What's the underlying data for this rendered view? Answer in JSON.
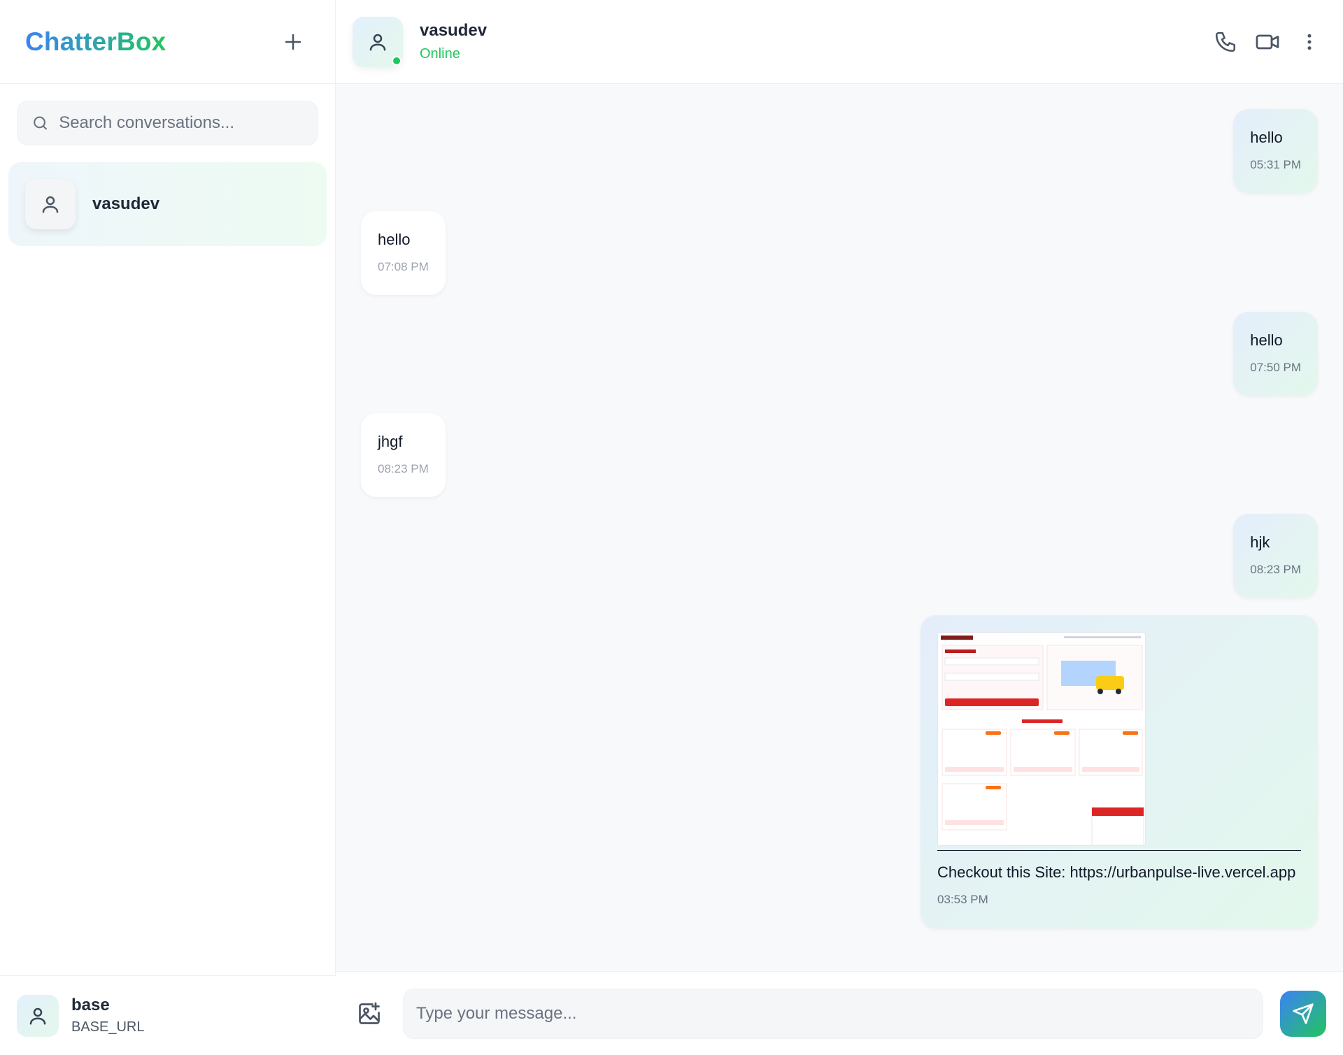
{
  "sidebar": {
    "brand": "ChatterBox",
    "search_placeholder": "Search conversations...",
    "conversations": [
      {
        "name": "vasudev"
      }
    ],
    "current_user": {
      "name": "base",
      "subtitle": "BASE_URL"
    }
  },
  "chat": {
    "contact_name": "vasudev",
    "contact_status": "Online",
    "messages": [
      {
        "direction": "out",
        "text": "hello",
        "time": "05:31 PM"
      },
      {
        "direction": "in",
        "text": "hello",
        "time": "07:08 PM"
      },
      {
        "direction": "out",
        "text": "hello",
        "time": "07:50 PM"
      },
      {
        "direction": "in",
        "text": "jhgf",
        "time": "08:23 PM"
      },
      {
        "direction": "out",
        "text": "hjk",
        "time": "08:23 PM"
      },
      {
        "direction": "out",
        "text": "Checkout this Site: https://urbanpulse-live.vercel.app",
        "time": "03:53 PM",
        "has_image": true
      }
    ],
    "composer_placeholder": "Type your message..."
  },
  "colors": {
    "brand_start": "#3b82f6",
    "brand_end": "#22c55e",
    "online": "#22c55e"
  },
  "icons": [
    "plus-icon",
    "search-icon",
    "user-icon",
    "phone-icon",
    "video-icon",
    "more-vertical-icon",
    "image-add-icon",
    "send-icon"
  ]
}
